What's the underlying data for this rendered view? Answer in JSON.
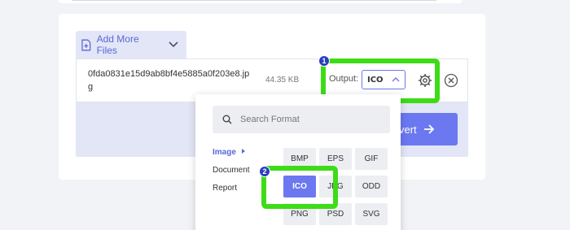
{
  "toolbar": {
    "add_more_files": "Add More Files"
  },
  "file": {
    "name": "0fda0831e15d9ab8bf4e5885a0f203e8.jpg",
    "size": "44.35 KB"
  },
  "output": {
    "label": "Output:",
    "value": "ICO"
  },
  "convert": {
    "label": "vert"
  },
  "callouts": {
    "one": "1",
    "two": "2"
  },
  "format_menu": {
    "search_placeholder": "Search Format",
    "categories": [
      "Image",
      "Document",
      "Report"
    ],
    "formats": [
      "BMP",
      "EPS",
      "GIF",
      "ICO",
      "JPG",
      "ODD",
      "PNG",
      "PSD",
      "SVG"
    ]
  },
  "colors": {
    "accent": "#6b78f0",
    "highlight": "#3ddc17",
    "badge": "#2a3fbf"
  }
}
